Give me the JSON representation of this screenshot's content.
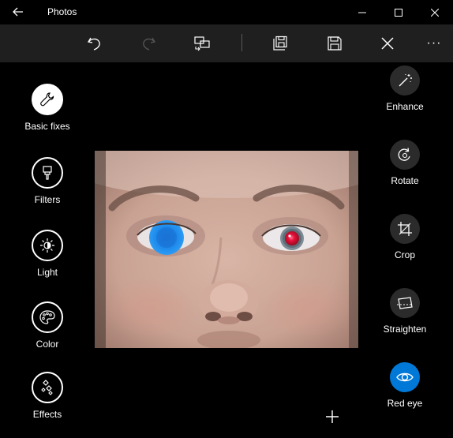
{
  "titlebar": {
    "title": "Photos"
  },
  "toolbar": {
    "icons": [
      "undo-icon",
      "redo-icon",
      "compare-icon",
      "save-copy-icon",
      "save-icon",
      "close-icon",
      "more-icon"
    ],
    "more_label": "···"
  },
  "left_tools": [
    {
      "label": "Basic fixes",
      "icon": "wrench-icon",
      "active": true
    },
    {
      "label": "Filters",
      "icon": "filter-brush-icon",
      "active": false
    },
    {
      "label": "Light",
      "icon": "sun-icon",
      "active": false
    },
    {
      "label": "Color",
      "icon": "palette-icon",
      "active": false
    },
    {
      "label": "Effects",
      "icon": "effects-icon",
      "active": false
    }
  ],
  "right_tools": [
    {
      "label": "Enhance",
      "icon": "magic-wand-icon",
      "selected": false
    },
    {
      "label": "Rotate",
      "icon": "rotate-icon",
      "selected": false
    },
    {
      "label": "Crop",
      "icon": "crop-icon",
      "selected": false
    },
    {
      "label": "Straighten",
      "icon": "straighten-icon",
      "selected": false
    },
    {
      "label": "Red eye",
      "icon": "eye-icon",
      "selected": true
    }
  ],
  "colors": {
    "accent": "#0078d7",
    "toolbar_bg": "#1f1f1f",
    "button_bg": "#2b2b2b"
  }
}
